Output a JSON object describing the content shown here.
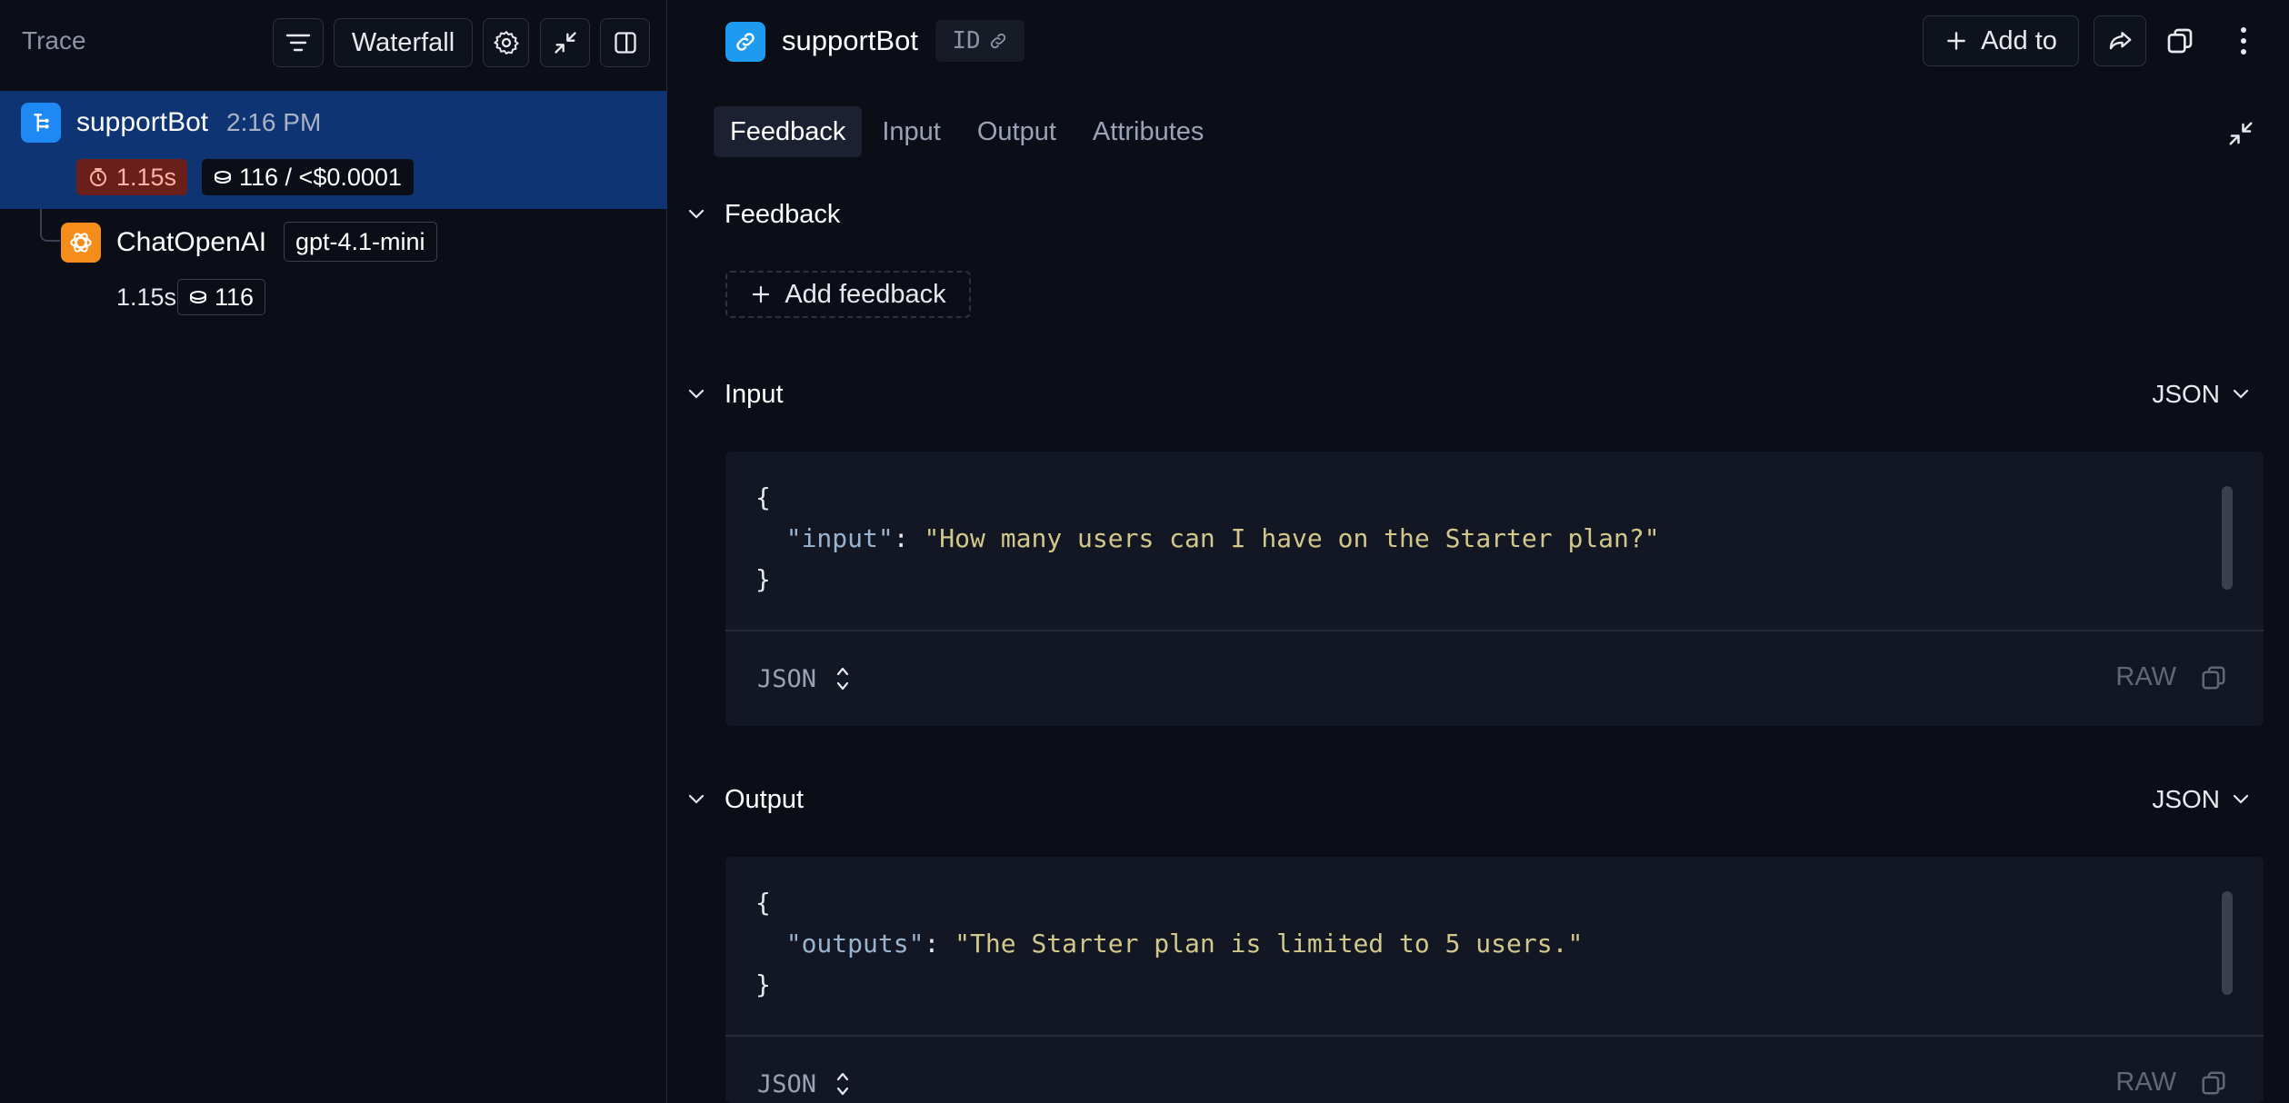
{
  "left_panel": {
    "title": "Trace",
    "view_mode_label": "Waterfall",
    "root_run": {
      "name": "supportBot",
      "time": "2:16 PM",
      "latency": "1.15s",
      "tokens_cost": "116 / <$0.0001"
    },
    "child_run": {
      "name": "ChatOpenAI",
      "model": "gpt-4.1-mini",
      "latency": "1.15s",
      "tokens": "116"
    }
  },
  "header": {
    "run_name": "supportBot",
    "id_label": "ID",
    "add_to_label": "Add to"
  },
  "tabs": [
    {
      "label": "Feedback",
      "active": true
    },
    {
      "label": "Input",
      "active": false
    },
    {
      "label": "Output",
      "active": false
    },
    {
      "label": "Attributes",
      "active": false
    }
  ],
  "feedback_section": {
    "title": "Feedback",
    "add_button_label": "Add feedback"
  },
  "input_section": {
    "title": "Input",
    "format": "JSON",
    "open_brace": "{",
    "key": "\"input\"",
    "colon": ": ",
    "value": "\"How many users can I have on the Starter plan?\"",
    "close_brace": "}",
    "footer_format": "JSON",
    "raw_label": "RAW"
  },
  "output_section": {
    "title": "Output",
    "format": "JSON",
    "open_brace": "{",
    "key": "\"outputs\"",
    "colon": ": ",
    "value": "\"The Starter plan is limited to 5 users.\"",
    "close_brace": "}",
    "footer_format": "JSON",
    "raw_label": "RAW"
  },
  "colors": {
    "selected_row": "#0f3474",
    "latency_badge": "#6b1f1a",
    "run_icon": "#1d9bf0",
    "llm_icon": "#f58d1a",
    "json_key": "#9ab3cf",
    "json_string": "#d2c88b"
  }
}
